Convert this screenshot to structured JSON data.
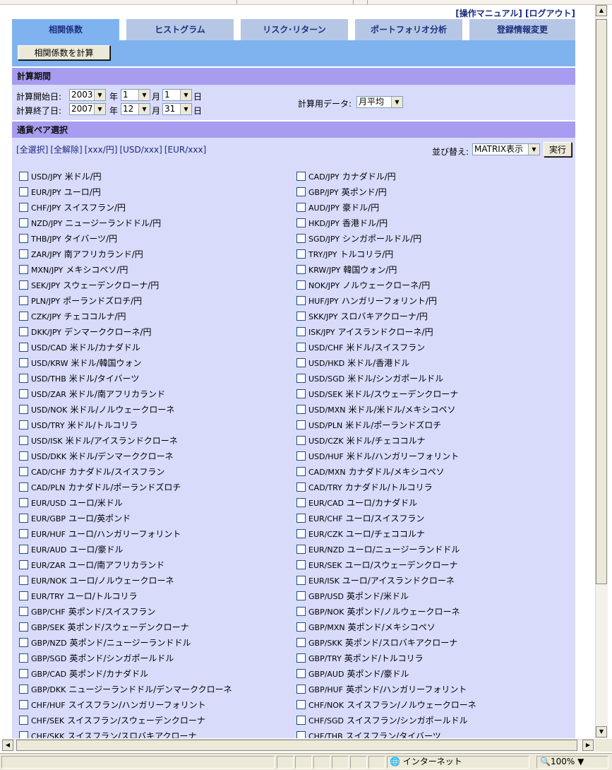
{
  "header": {
    "manual_link": "[操作マニュアル]",
    "logout_link": "[ログアウト]"
  },
  "tabs": [
    {
      "label": "相関係数"
    },
    {
      "label": "ヒストグラム"
    },
    {
      "label": "リスク･リターン"
    },
    {
      "label": "ポートフォリオ分析"
    },
    {
      "label": "登録情報変更"
    }
  ],
  "toolbar": {
    "calc_button": "相関係数を計算"
  },
  "period": {
    "title": "計算期間",
    "start_label": "計算開始日:",
    "end_label": "計算終了日:",
    "start": {
      "year": "2003",
      "month": "1",
      "day": "1"
    },
    "end": {
      "year": "2007",
      "month": "12",
      "day": "31"
    },
    "unit_year": "年",
    "unit_month": "月",
    "unit_day": "日",
    "data_label": "計算用データ:",
    "data_value": "月平均"
  },
  "pairs_section": {
    "title": "通貨ペア選択",
    "links": [
      "[全選択]",
      "[全解除]",
      "[xxx/円]",
      "[USD/xxx]",
      "[EUR/xxx]"
    ],
    "sort_label": "並び替え:",
    "sort_value": "MATRIX表示",
    "exec_button": "実行"
  },
  "pairs_left": [
    {
      "code": "USD/JPY",
      "name": "米ドル/円"
    },
    {
      "code": "EUR/JPY",
      "name": "ユーロ/円"
    },
    {
      "code": "CHF/JPY",
      "name": "スイスフラン/円"
    },
    {
      "code": "NZD/JPY",
      "name": "ニュージーランドドル/円"
    },
    {
      "code": "THB/JPY",
      "name": "タイバーツ/円"
    },
    {
      "code": "ZAR/JPY",
      "name": "南アフリカランド/円"
    },
    {
      "code": "MXN/JPY",
      "name": "メキシコペソ/円"
    },
    {
      "code": "SEK/JPY",
      "name": "スウェーデンクローナ/円"
    },
    {
      "code": "PLN/JPY",
      "name": "ポーランドズロチ/円"
    },
    {
      "code": "CZK/JPY",
      "name": "チェココルナ/円"
    },
    {
      "code": "DKK/JPY",
      "name": "デンマーククローネ/円"
    },
    {
      "code": "USD/CAD",
      "name": "米ドル/カナダドル"
    },
    {
      "code": "USD/KRW",
      "name": "米ドル/韓国ウォン"
    },
    {
      "code": "USD/THB",
      "name": "米ドル/タイバーツ"
    },
    {
      "code": "USD/ZAR",
      "name": "米ドル/南アフリカランド"
    },
    {
      "code": "USD/NOK",
      "name": "米ドル/ノルウェークローネ"
    },
    {
      "code": "USD/TRY",
      "name": "米ドル/トルコリラ"
    },
    {
      "code": "USD/ISK",
      "name": "米ドル/アイスランドクローネ"
    },
    {
      "code": "USD/DKK",
      "name": "米ドル/デンマーククローネ"
    },
    {
      "code": "CAD/CHF",
      "name": "カナダドル/スイスフラン"
    },
    {
      "code": "CAD/PLN",
      "name": "カナダドル/ポーランドズロチ"
    },
    {
      "code": "EUR/USD",
      "name": "ユーロ/米ドル"
    },
    {
      "code": "EUR/GBP",
      "name": "ユーロ/英ポンド"
    },
    {
      "code": "EUR/HUF",
      "name": "ユーロ/ハンガリーフォリント"
    },
    {
      "code": "EUR/AUD",
      "name": "ユーロ/豪ドル"
    },
    {
      "code": "EUR/ZAR",
      "name": "ユーロ/南アフリカランド"
    },
    {
      "code": "EUR/NOK",
      "name": "ユーロ/ノルウェークローネ"
    },
    {
      "code": "EUR/TRY",
      "name": "ユーロ/トルコリラ"
    },
    {
      "code": "GBP/CHF",
      "name": "英ポンド/スイスフラン"
    },
    {
      "code": "GBP/SEK",
      "name": "英ポンド/スウェーデンクローナ"
    },
    {
      "code": "GBP/NZD",
      "name": "英ポンド/ニュージーランドドル"
    },
    {
      "code": "GBP/SGD",
      "name": "英ポンド/シンガポールドル"
    },
    {
      "code": "GBP/CAD",
      "name": "英ポンド/カナダドル"
    },
    {
      "code": "GBP/DKK",
      "name": "ニュージーランドドル/デンマーククローネ"
    },
    {
      "code": "CHF/HUF",
      "name": "スイスフラン/ハンガリーフォリント"
    },
    {
      "code": "CHF/SEK",
      "name": "スイスフラン/スウェーデンクローナ"
    },
    {
      "code": "CHF/SKK",
      "name": "スイスフラン/スロバキアクローナ"
    }
  ],
  "pairs_right": [
    {
      "code": "CAD/JPY",
      "name": "カナダドル/円"
    },
    {
      "code": "GBP/JPY",
      "name": "英ポンド/円"
    },
    {
      "code": "AUD/JPY",
      "name": "豪ドル/円"
    },
    {
      "code": "HKD/JPY",
      "name": "香港ドル/円"
    },
    {
      "code": "SGD/JPY",
      "name": "シンガポールドル/円"
    },
    {
      "code": "TRY/JPY",
      "name": "トルコリラ/円"
    },
    {
      "code": "KRW/JPY",
      "name": "韓国ウォン/円"
    },
    {
      "code": "NOK/JPY",
      "name": "ノルウェークローネ/円"
    },
    {
      "code": "HUF/JPY",
      "name": "ハンガリーフォリント/円"
    },
    {
      "code": "SKK/JPY",
      "name": "スロバキアクローナ/円"
    },
    {
      "code": "ISK/JPY",
      "name": "アイスランドクローネ/円"
    },
    {
      "code": "USD/CHF",
      "name": "米ドル/スイスフラン"
    },
    {
      "code": "USD/HKD",
      "name": "米ドル/香港ドル"
    },
    {
      "code": "USD/SGD",
      "name": "米ドル/シンガポールドル"
    },
    {
      "code": "USD/SEK",
      "name": "米ドル/スウェーデンクローナ"
    },
    {
      "code": "USD/MXN",
      "name": "米ドル/米ドル/メキシコペソ"
    },
    {
      "code": "USD/PLN",
      "name": "米ドル/ポーランドズロチ"
    },
    {
      "code": "USD/CZK",
      "name": "米ドル/チェココルナ"
    },
    {
      "code": "USD/HUF",
      "name": "米ドル/ハンガリーフォリント"
    },
    {
      "code": "CAD/MXN",
      "name": "カナダドル/メキシコペソ"
    },
    {
      "code": "CAD/TRY",
      "name": "カナダドル/トルコリラ"
    },
    {
      "code": "EUR/CAD",
      "name": "ユーロ/カナダドル"
    },
    {
      "code": "EUR/CHF",
      "name": "ユーロ/スイスフラン"
    },
    {
      "code": "EUR/CZK",
      "name": "ユーロ/チェココルナ"
    },
    {
      "code": "EUR/NZD",
      "name": "ユーロ/ニュージーランドドル"
    },
    {
      "code": "EUR/SEK",
      "name": "ユーロ/スウェーデンクローナ"
    },
    {
      "code": "EUR/ISK",
      "name": "ユーロ/アイスランドクローネ"
    },
    {
      "code": "GBP/USD",
      "name": "英ポンド/米ドル"
    },
    {
      "code": "GBP/NOK",
      "name": "英ポンド/ノルウェークローネ"
    },
    {
      "code": "GBP/MXN",
      "name": "英ポンド/メキシコペソ"
    },
    {
      "code": "GBP/SKK",
      "name": "英ポンド/スロバキアクローナ"
    },
    {
      "code": "GBP/TRY",
      "name": "英ポンド/トルコリラ"
    },
    {
      "code": "GBP/AUD",
      "name": "英ポンド/豪ドル"
    },
    {
      "code": "GBP/HUF",
      "name": "英ポンド/ハンガリーフォリント"
    },
    {
      "code": "CHF/NOK",
      "name": "スイスフラン/ノルウェークローネ"
    },
    {
      "code": "CHF/SGD",
      "name": "スイスフラン/シンガポールドル"
    },
    {
      "code": "CHF/THB",
      "name": "スイスフラン/タイバーツ"
    }
  ],
  "statusbar": {
    "zone": "インターネット",
    "zoom": "100%"
  },
  "colors": {
    "tab_active": "#7fb3f0",
    "tab": "#b6c7e6",
    "section_header": "#a89cf0",
    "section_body": "#d8dbfa",
    "link": "#1b2a80"
  }
}
